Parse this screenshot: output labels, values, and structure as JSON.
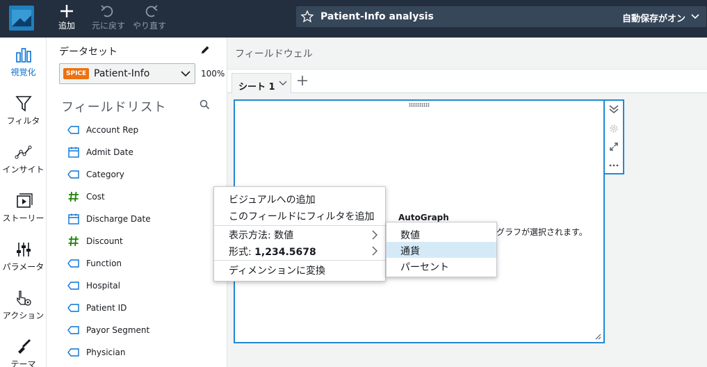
{
  "toolbar": {
    "add_label": "追加",
    "undo_label": "元に戻す",
    "redo_label": "やり直す"
  },
  "header": {
    "analysis_title": "Patient-Info analysis",
    "autosave": "自動保存がオン"
  },
  "rail": {
    "visualize": "視覚化",
    "filter": "フィルタ",
    "insights": "インサイト",
    "story": "ストーリー",
    "parameters": "パラメータ",
    "actions": "アクション",
    "themes": "テーマ"
  },
  "dataset": {
    "label": "データセット",
    "badge": "SPICE",
    "name": "Patient-Info",
    "percent": "100%"
  },
  "field_list": {
    "title": "フィールドリスト",
    "fields": [
      {
        "name": "Account Rep",
        "type": "dimension"
      },
      {
        "name": "Admit Date",
        "type": "date"
      },
      {
        "name": "Category",
        "type": "dimension"
      },
      {
        "name": "Cost",
        "type": "measure"
      },
      {
        "name": "Discharge Date",
        "type": "date"
      },
      {
        "name": "Discount",
        "type": "measure"
      },
      {
        "name": "Function",
        "type": "dimension"
      },
      {
        "name": "Hospital",
        "type": "dimension"
      },
      {
        "name": "Patient ID",
        "type": "dimension"
      },
      {
        "name": "Payor Segment",
        "type": "dimension"
      },
      {
        "name": "Physician",
        "type": "dimension"
      }
    ]
  },
  "main": {
    "field_wells": "フィールドウェル",
    "sheet_tab": "シート 1",
    "visual_title": "AutoGraph",
    "visual_desc": "グラフが選択されます。"
  },
  "context_menu": {
    "add_to_visual": "ビジュアルへの追加",
    "add_filter": "このフィールドにフィルタを追加",
    "show_as_prefix": "表示方法: ",
    "show_as_value": "数値",
    "format_prefix": "形式: ",
    "format_value": "1,234.5678",
    "convert_dimension": "ディメンションに変換"
  },
  "submenu": {
    "items": [
      "数値",
      "通貨",
      "パーセント"
    ],
    "highlighted": "通貨"
  },
  "colors": {
    "topbar": "#232f3e",
    "accent": "#1f8ad1",
    "measure": "#1d8102",
    "spice": "#ec7211"
  }
}
